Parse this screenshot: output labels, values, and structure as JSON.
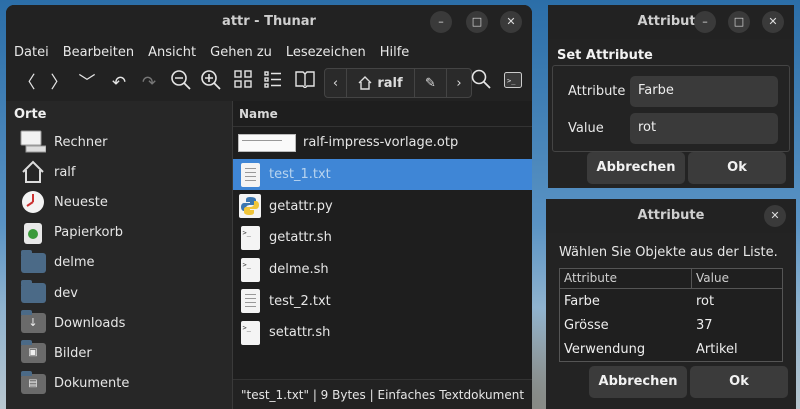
{
  "thunar": {
    "title": "attr - Thunar",
    "menu": [
      "Datei",
      "Bearbeiten",
      "Ansicht",
      "Gehen zu",
      "Lesezeichen",
      "Hilfe"
    ],
    "path": {
      "home_label": "ralf"
    },
    "sidebar": {
      "header": "Orte",
      "items": [
        {
          "label": "Rechner",
          "icon": "computer-icon"
        },
        {
          "label": "ralf",
          "icon": "home-icon"
        },
        {
          "label": "Neueste",
          "icon": "clock-icon"
        },
        {
          "label": "Papierkorb",
          "icon": "trash-icon"
        },
        {
          "label": "delme",
          "icon": "folder-icon"
        },
        {
          "label": "dev",
          "icon": "folder-icon"
        },
        {
          "label": "Downloads",
          "icon": "downloads-folder-icon"
        },
        {
          "label": "Bilder",
          "icon": "pictures-folder-icon"
        },
        {
          "label": "Dokumente",
          "icon": "documents-folder-icon"
        }
      ]
    },
    "filelist": {
      "column": "Name",
      "files": [
        {
          "name": "ralf-impress-vorlage.otp",
          "icon": "presentation-template-icon",
          "selected": false
        },
        {
          "name": "test_1.txt",
          "icon": "text-file-icon",
          "selected": true
        },
        {
          "name": "getattr.py",
          "icon": "python-file-icon",
          "selected": false
        },
        {
          "name": "getattr.sh",
          "icon": "shell-script-icon",
          "selected": false
        },
        {
          "name": "delme.sh",
          "icon": "shell-script-icon",
          "selected": false
        },
        {
          "name": "test_2.txt",
          "icon": "text-file-icon",
          "selected": false
        },
        {
          "name": "setattr.sh",
          "icon": "shell-script-icon",
          "selected": false
        }
      ]
    },
    "status": "\"test_1.txt\"  |  9 Bytes  |  Einfaches Textdokument"
  },
  "set_dialog": {
    "title": "Attribute",
    "group_title": "Set Attribute",
    "attribute_label": "Attribute",
    "attribute_value": "Farbe",
    "value_label": "Value",
    "value_value": "rot",
    "cancel": "Abbrechen",
    "ok": "Ok"
  },
  "list_dialog": {
    "title": "Attribute",
    "prompt": "Wählen Sie Objekte aus der Liste.",
    "columns": [
      "Attribute",
      "Value"
    ],
    "rows": [
      [
        "Farbe",
        "rot"
      ],
      [
        "Grösse",
        "37"
      ],
      [
        "Verwendung",
        "Artikel"
      ]
    ],
    "cancel": "Abbrechen",
    "ok": "Ok"
  },
  "colors": {
    "selection": "#3f86d6",
    "window_bg": "#222222",
    "button_bg": "#3b3b3b"
  }
}
